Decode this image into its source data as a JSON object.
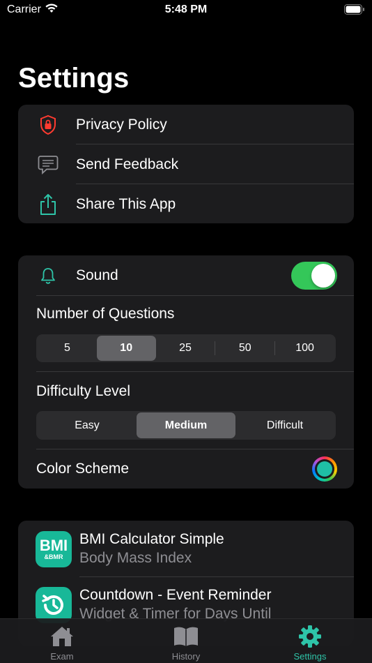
{
  "status_bar": {
    "carrier": "Carrier",
    "time": "5:48 PM"
  },
  "page_title": "Settings",
  "links": [
    {
      "label": "Privacy Policy",
      "icon": "shield-lock-icon"
    },
    {
      "label": "Send Feedback",
      "icon": "message-icon"
    },
    {
      "label": "Share This App",
      "icon": "share-icon"
    }
  ],
  "preferences": {
    "sound_label": "Sound",
    "sound_on": true,
    "questions_label": "Number of Questions",
    "questions_options": [
      "5",
      "10",
      "25",
      "50",
      "100"
    ],
    "questions_selected": "10",
    "difficulty_label": "Difficulty Level",
    "difficulty_options": [
      "Easy",
      "Medium",
      "Difficult"
    ],
    "difficulty_selected": "Medium",
    "color_scheme_label": "Color Scheme",
    "color_scheme_value": "#1fbfa6"
  },
  "apps": [
    {
      "title": "BMI Calculator Simple",
      "subtitle": "Body Mass Index",
      "icon_text": "BMI",
      "icon_subtext": "&BMR"
    },
    {
      "title": "Countdown - Event Reminder",
      "subtitle": "Widget & Timer for Days Until",
      "icon": "history-clock-icon"
    }
  ],
  "tabs": [
    {
      "label": "Exam",
      "icon": "house-icon",
      "active": false
    },
    {
      "label": "History",
      "icon": "book-icon",
      "active": false
    },
    {
      "label": "Settings",
      "icon": "gear-icon",
      "active": true
    }
  ],
  "colors": {
    "accent": "#2ec4a8",
    "toggle_on": "#34c759",
    "danger": "#ff3b30",
    "card": "#1c1c1e"
  }
}
